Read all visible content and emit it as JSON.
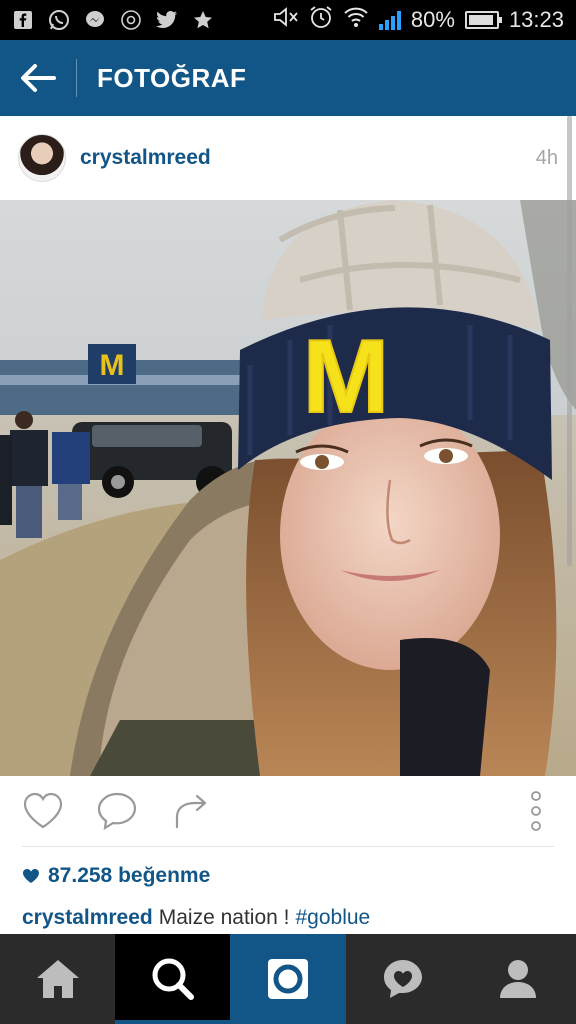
{
  "status_bar": {
    "battery": "80%",
    "time": "13:23",
    "icons": [
      "facebook-icon",
      "whatsapp-icon",
      "messenger-icon",
      "at-icon",
      "twitter-icon",
      "star-icon",
      "mute-icon",
      "alarm-icon",
      "wifi-icon",
      "signal-icon",
      "battery-icon"
    ]
  },
  "header": {
    "title": "FOTOĞRAF"
  },
  "post": {
    "username": "crystalmreed",
    "time": "4h",
    "likes": "87.258 beğenme",
    "caption": {
      "username": "crystalmreed",
      "text": "Maize nation !",
      "hashtag": "#goblue"
    }
  },
  "photo": {
    "hat_letter": "M",
    "stadium_letter": "M"
  },
  "colors": {
    "brand": "#125688",
    "status_bar": "#000000",
    "nav_bg": "#2b2b2b",
    "hat_yellow": "#f6e21a",
    "hat_navy": "#1e2a4a"
  },
  "bottom_nav": [
    "home-icon",
    "search-icon",
    "camera-icon",
    "activity-icon",
    "profile-icon"
  ]
}
